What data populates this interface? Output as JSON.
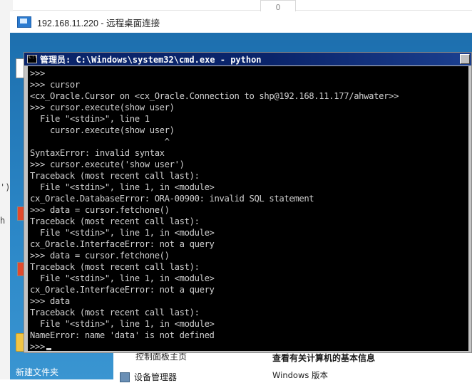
{
  "host": {
    "number_box": "0",
    "left_fragments": [
      "')",
      "h"
    ]
  },
  "rdp": {
    "title": "192.168.11.220 - 远程桌面连接"
  },
  "desktop": {
    "folder_label": "新建文件夹"
  },
  "control_panel": {
    "text_partial": "控制面板主页",
    "heading": "查看有关计算机的基本信息",
    "item_device_manager": "设备管理器",
    "os_label": "Windows 版本"
  },
  "console": {
    "title": "管理员: C:\\Windows\\system32\\cmd.exe - python",
    "lines": [
      ">>>",
      ">>> cursor",
      "<cx_Oracle.Cursor on <cx_Oracle.Connection to shp@192.168.11.177/ahwater>>",
      ">>> cursor.execute(show user)",
      "  File \"<stdin>\", line 1",
      "    cursor.execute(show user)",
      "                           ^",
      "SyntaxError: invalid syntax",
      ">>> cursor.execute('show user')",
      "Traceback (most recent call last):",
      "  File \"<stdin>\", line 1, in <module>",
      "cx_Oracle.DatabaseError: ORA-00900: invalid SQL statement",
      ">>> data = cursor.fetchone()",
      "Traceback (most recent call last):",
      "  File \"<stdin>\", line 1, in <module>",
      "cx_Oracle.InterfaceError: not a query",
      ">>> data = cursor.fetchone()",
      "Traceback (most recent call last):",
      "  File \"<stdin>\", line 1, in <module>",
      "cx_Oracle.InterfaceError: not a query",
      ">>> data",
      "Traceback (most recent call last):",
      "  File \"<stdin>\", line 1, in <module>",
      "NameError: name 'data' is not defined",
      ">>>"
    ]
  }
}
